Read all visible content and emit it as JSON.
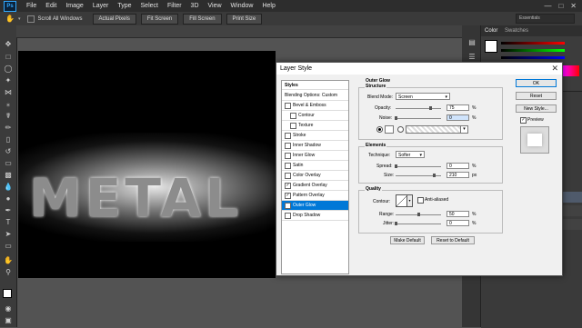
{
  "app": {
    "logo": "Ps",
    "menu": [
      "File",
      "Edit",
      "Image",
      "Layer",
      "Type",
      "Select",
      "Filter",
      "3D",
      "View",
      "Window",
      "Help"
    ]
  },
  "options_bar": {
    "scroll_all_windows": "Scroll All Windows",
    "buttons": [
      "Actual Pixels",
      "Fit Screen",
      "Fill Screen",
      "Print Size"
    ],
    "workspace": "Essentials"
  },
  "panels": {
    "tab_color": "Color",
    "tab_swatches": "Swatches"
  },
  "canvas": {
    "text": "METAL"
  },
  "dialog": {
    "title": "Layer Style",
    "close": "✕",
    "styles_header": "Styles",
    "style_items": [
      {
        "label": "Blending Options: Custom",
        "checkbox": false,
        "checked": false,
        "selected": false,
        "indent": false
      },
      {
        "label": "Bevel & Emboss",
        "checkbox": true,
        "checked": false,
        "selected": false,
        "indent": false
      },
      {
        "label": "Contour",
        "checkbox": true,
        "checked": false,
        "selected": false,
        "indent": true
      },
      {
        "label": "Texture",
        "checkbox": true,
        "checked": false,
        "selected": false,
        "indent": true
      },
      {
        "label": "Stroke",
        "checkbox": true,
        "checked": false,
        "selected": false,
        "indent": false
      },
      {
        "label": "Inner Shadow",
        "checkbox": true,
        "checked": false,
        "selected": false,
        "indent": false
      },
      {
        "label": "Inner Glow",
        "checkbox": true,
        "checked": false,
        "selected": false,
        "indent": false
      },
      {
        "label": "Satin",
        "checkbox": true,
        "checked": false,
        "selected": false,
        "indent": false
      },
      {
        "label": "Color Overlay",
        "checkbox": true,
        "checked": false,
        "selected": false,
        "indent": false
      },
      {
        "label": "Gradient Overlay",
        "checkbox": true,
        "checked": true,
        "selected": false,
        "indent": false
      },
      {
        "label": "Pattern Overlay",
        "checkbox": true,
        "checked": true,
        "selected": false,
        "indent": false
      },
      {
        "label": "Outer Glow",
        "checkbox": true,
        "checked": true,
        "selected": true,
        "indent": false
      },
      {
        "label": "Drop Shadow",
        "checkbox": true,
        "checked": false,
        "selected": false,
        "indent": false
      }
    ],
    "outer_glow": {
      "heading": "Outer Glow",
      "structure": "Structure",
      "blend_mode_label": "Blend Mode:",
      "blend_mode": "Screen",
      "opacity_label": "Opacity:",
      "opacity": "75",
      "opacity_level": 0.75,
      "noise_label": "Noise:",
      "noise": "0",
      "noise_level": 0.0,
      "pct": "%"
    },
    "elements": {
      "heading": "Elements",
      "technique_label": "Technique:",
      "technique": "Softer",
      "spread_label": "Spread:",
      "spread": "0",
      "spread_level": 0.0,
      "size_label": "Size:",
      "size": "210",
      "size_level": 0.84,
      "pct": "%",
      "px": "px"
    },
    "quality": {
      "heading": "Quality",
      "contour_label": "Contour:",
      "anti_aliased": "Anti-aliased",
      "range_label": "Range:",
      "range": "50",
      "range_level": 0.5,
      "jitter_label": "Jitter:",
      "jitter": "0",
      "jitter_level": 0.0,
      "pct": "%"
    },
    "make_default": "Make Default",
    "reset_to_default": "Reset to Default",
    "ok": "OK",
    "reset": "Reset",
    "new_style": "New Style...",
    "preview": "Preview",
    "preview_checked": true
  },
  "colors": {
    "accent": "#0078d7",
    "ps_blue": "#31a8ff"
  }
}
